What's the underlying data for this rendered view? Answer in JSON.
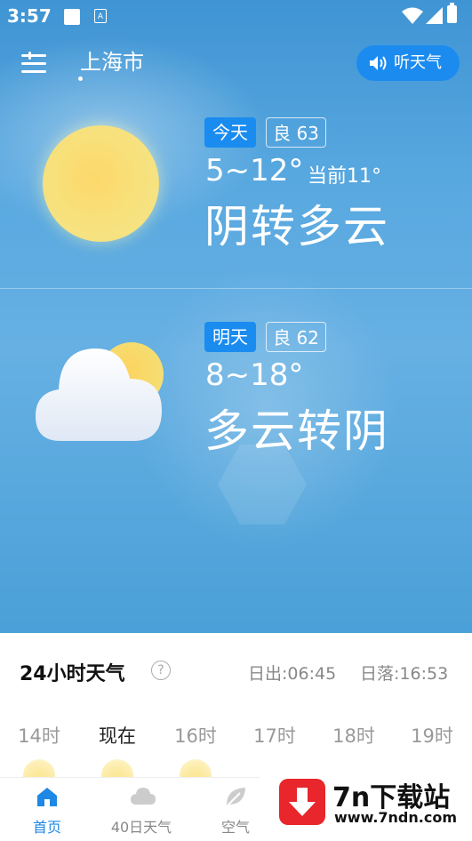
{
  "status_bar": {
    "time": "3:57",
    "notif_icon": "A"
  },
  "header": {
    "city": "上海市",
    "listen_label": "听天气"
  },
  "today": {
    "day_tag": "今天",
    "aqi": "良 63",
    "temp_range": "5~12°",
    "current": "当前11°",
    "condition": "阴转多云",
    "icon": "sun-icon"
  },
  "tomorrow": {
    "day_tag": "明天",
    "aqi": "良 62",
    "temp_range": "8~18°",
    "condition": "多云转阴",
    "icon": "partly-cloudy-icon"
  },
  "hourly": {
    "title": "24小时天气",
    "sunrise": "日出:06:45",
    "sunset": "日落:16:53",
    "hours": [
      "14时",
      "现在",
      "16时",
      "17时",
      "18时",
      "19时"
    ]
  },
  "nav": {
    "items": [
      {
        "label": "首页",
        "icon": "home-icon"
      },
      {
        "label": "40日天气",
        "icon": "cloud-icon"
      },
      {
        "label": "空气",
        "icon": "leaf-icon"
      }
    ]
  },
  "watermark": {
    "title": "7n下载站",
    "url": "www.7ndn.com"
  },
  "colors": {
    "accent": "#1a8cf0",
    "sky": "#58a8e0"
  }
}
